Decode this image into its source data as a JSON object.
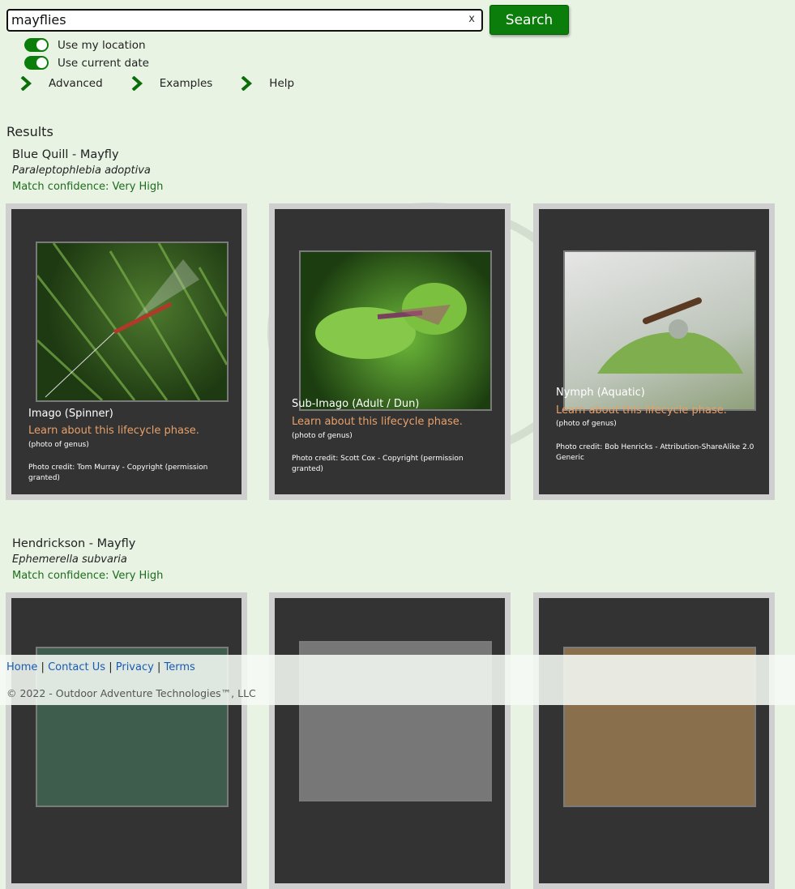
{
  "search": {
    "value": "mayflies",
    "clear_label": "x",
    "button_label": "Search"
  },
  "toggles": [
    {
      "label": "Use my location",
      "on": true
    },
    {
      "label": "Use current date",
      "on": true
    }
  ],
  "links": [
    "Advanced",
    "Examples",
    "Help"
  ],
  "results_heading": "Results",
  "results": [
    {
      "name": "Blue Quill - Mayfly",
      "scientific": "Paraleptophlebia adoptiva",
      "confidence": "Match confidence: Very High",
      "cards": [
        {
          "phase": "Imago (Spinner)",
          "learn": "Learn about this lifecycle phase.",
          "genus": "(photo of genus)",
          "credit": "Photo credit: Tom Murray - Copyright (permission granted)"
        },
        {
          "phase": "Sub-Imago (Adult / Dun)",
          "learn": "Learn about this lifecycle phase.",
          "genus": "(photo of genus)",
          "credit": "Photo credit: Scott Cox - Copyright (permission granted)"
        },
        {
          "phase": "Nymph (Aquatic)",
          "learn": "Learn about this lifecycle phase.",
          "genus": "(photo of genus)",
          "credit": "Photo credit: Bob Henricks - Attribution-ShareAlike 2.0 Generic"
        }
      ]
    },
    {
      "name": "Hendrickson - Mayfly",
      "scientific": "Ephemerella subvaria",
      "confidence": "Match confidence: Very High"
    }
  ],
  "footer": {
    "links": [
      "Home",
      "Contact Us",
      "Privacy",
      "Terms"
    ],
    "separator": "|",
    "copyright": "© 2022 - Outdoor Adventure Technologies™, LLC"
  },
  "colors": {
    "background": "#e8f3e4",
    "accent": "#0a7d0a",
    "card": "#333333",
    "learn_link": "#e8a06a",
    "confidence": "#1d6b1d"
  }
}
